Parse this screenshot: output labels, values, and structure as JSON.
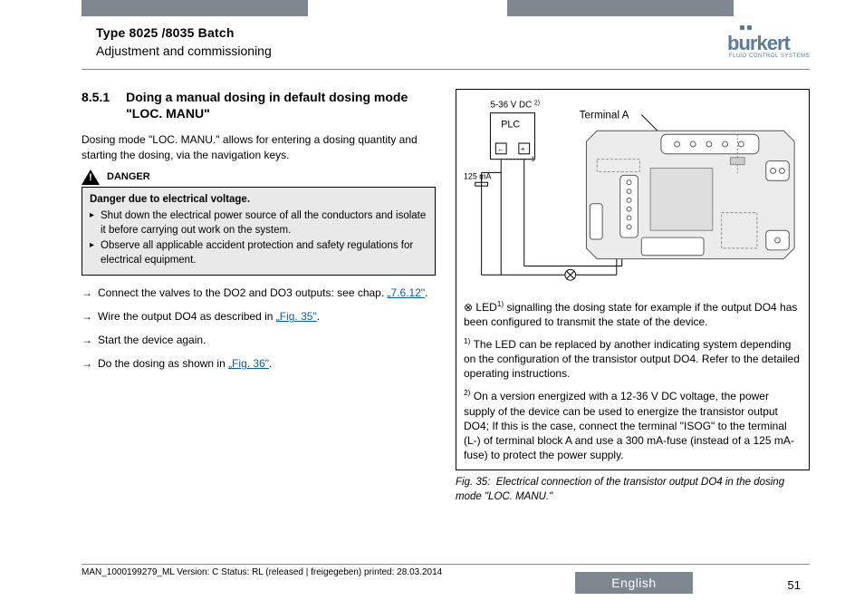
{
  "header": {
    "type_line": "Type 8025 /8035 Batch",
    "subtitle": "Adjustment and commissioning",
    "logo_text": "burkert",
    "logo_tag": "FLUID CONTROL SYSTEMS"
  },
  "section": {
    "number": "8.5.1",
    "title": "Doing a manual dosing in default dosing mode \"LOC. MANU\""
  },
  "intro": "Dosing mode \"LOC. MANU.\" allows for entering a dosing quantity and starting the dosing, via the navigation keys.",
  "danger": {
    "label": "DANGER",
    "title": "Danger due to electrical voltage.",
    "items": [
      "Shut down the electrical power source of all the conductors and isolate it before carrying out work on the system.",
      "Observe all applicable accident protection and safety regulations for electrical equipment."
    ]
  },
  "steps": [
    {
      "pre": "Connect the valves to the DO2 and DO3 outputs: see chap. ",
      "link": "„7.6.12\"",
      "post": "."
    },
    {
      "pre": "Wire the output DO4 as described in ",
      "link": "„Fig. 35\"",
      "post": "."
    },
    {
      "pre": "Start the device again.",
      "link": "",
      "post": ""
    },
    {
      "pre": "Do the dosing as shown in ",
      "link": "„Fig. 36\"",
      "post": "."
    }
  ],
  "figure": {
    "voltage": "5-36 V DC",
    "voltage_sup": "2)",
    "plc": "PLC",
    "current": "125 mA",
    "terminal": "Terminal A",
    "led_marker": "⊗",
    "led_text_1": "LED",
    "led_sup": "1)",
    "led_text_2": " signalling the dosing state for example if the output DO4 has been configured to transmit the state of the device.",
    "note1_sup": "1)",
    "note1": " The LED can be replaced by another indicating system depending on the configuration of the transistor output DO4. Refer to the detailed operating instructions.",
    "note2_sup": "2)",
    "note2": " On a version energized with a 12-36 V DC voltage, the power supply of the device can be used to energize the transistor output DO4; If this is the case, connect the terminal \"ISOG\" to the terminal (L-) of terminal block A and use a 300 mA-fuse (instead of a 125 mA-fuse) to protect the power supply.",
    "caption_label": "Fig. 35:",
    "caption_text": "Electrical connection of the transistor output DO4 in the dosing mode \"LOC. MANU.\""
  },
  "footer": {
    "meta": "MAN_1000199279_ML  Version: C Status: RL (released | freigegeben)  printed: 28.03.2014",
    "language": "English",
    "page": "51"
  }
}
